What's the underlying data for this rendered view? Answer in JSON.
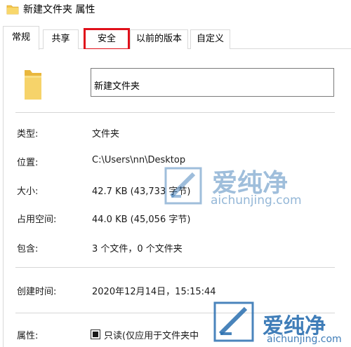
{
  "window": {
    "title": "新建文件夹 属性",
    "icon": "folder-icon"
  },
  "tabs": [
    {
      "label": "常规",
      "active": true
    },
    {
      "label": "共享",
      "active": false
    },
    {
      "label": "安全",
      "active": false,
      "highlighted": true
    },
    {
      "label": "以前的版本",
      "active": false
    },
    {
      "label": "自定义",
      "active": false
    }
  ],
  "folder": {
    "name": "新建文件夹",
    "icon": "folder-icon"
  },
  "properties": {
    "type": {
      "label": "类型:",
      "value": "文件夹"
    },
    "location": {
      "label": "位置:",
      "value": "C:\\Users\\nn\\Desktop"
    },
    "size": {
      "label": "大小:",
      "value": "42.7 KB (43,733 字节)"
    },
    "disk": {
      "label": "占用空间:",
      "value": "44.0 KB (45,056 字节)"
    },
    "contains": {
      "label": "包含:",
      "value": "3 个文件，0 个文件夹"
    },
    "created": {
      "label": "创建时间:",
      "value": "2020年12月14日，15:15:44"
    },
    "attributes": {
      "label": "属性:",
      "readonly_label": "只读(仅应用于文件夹中",
      "readonly_state": "indeterminate"
    }
  },
  "watermark": {
    "cn": "爱纯净",
    "url": "aichunjing.com"
  },
  "colors": {
    "highlight": "#e0101a",
    "folder": "#f2c94c",
    "watermark": "#2a6fb0"
  }
}
